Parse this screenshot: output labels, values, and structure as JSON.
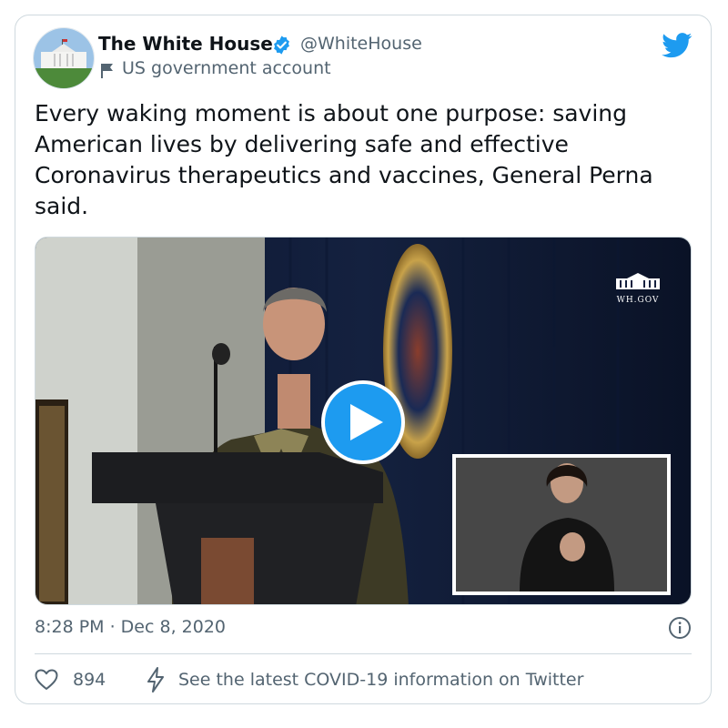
{
  "author": {
    "display_name": "The White House",
    "handle": "@WhiteHouse",
    "account_label": "US government account",
    "verified": true
  },
  "tweet": {
    "text": "Every waking moment is about one purpose: saving American lives by delivering safe and effective Coronavirus therapeutics and vaccines, General Perna said."
  },
  "media": {
    "type": "video",
    "watermark": "WH.GOV"
  },
  "footer": {
    "timestamp": "8:28 PM · Dec 8, 2020",
    "like_count": "894",
    "covid_link": "See the latest COVID-19 information on Twitter"
  },
  "icons": {
    "verified": "verified-badge-icon",
    "flag": "flag-icon",
    "brand": "twitter-bird-icon",
    "play": "play-icon",
    "info": "info-icon",
    "like": "heart-icon",
    "covid": "lightning-icon"
  },
  "colors": {
    "accent": "#1d9bf0",
    "secondary_text": "#536471",
    "primary_text": "#0f1419",
    "border": "#cfd9de"
  }
}
